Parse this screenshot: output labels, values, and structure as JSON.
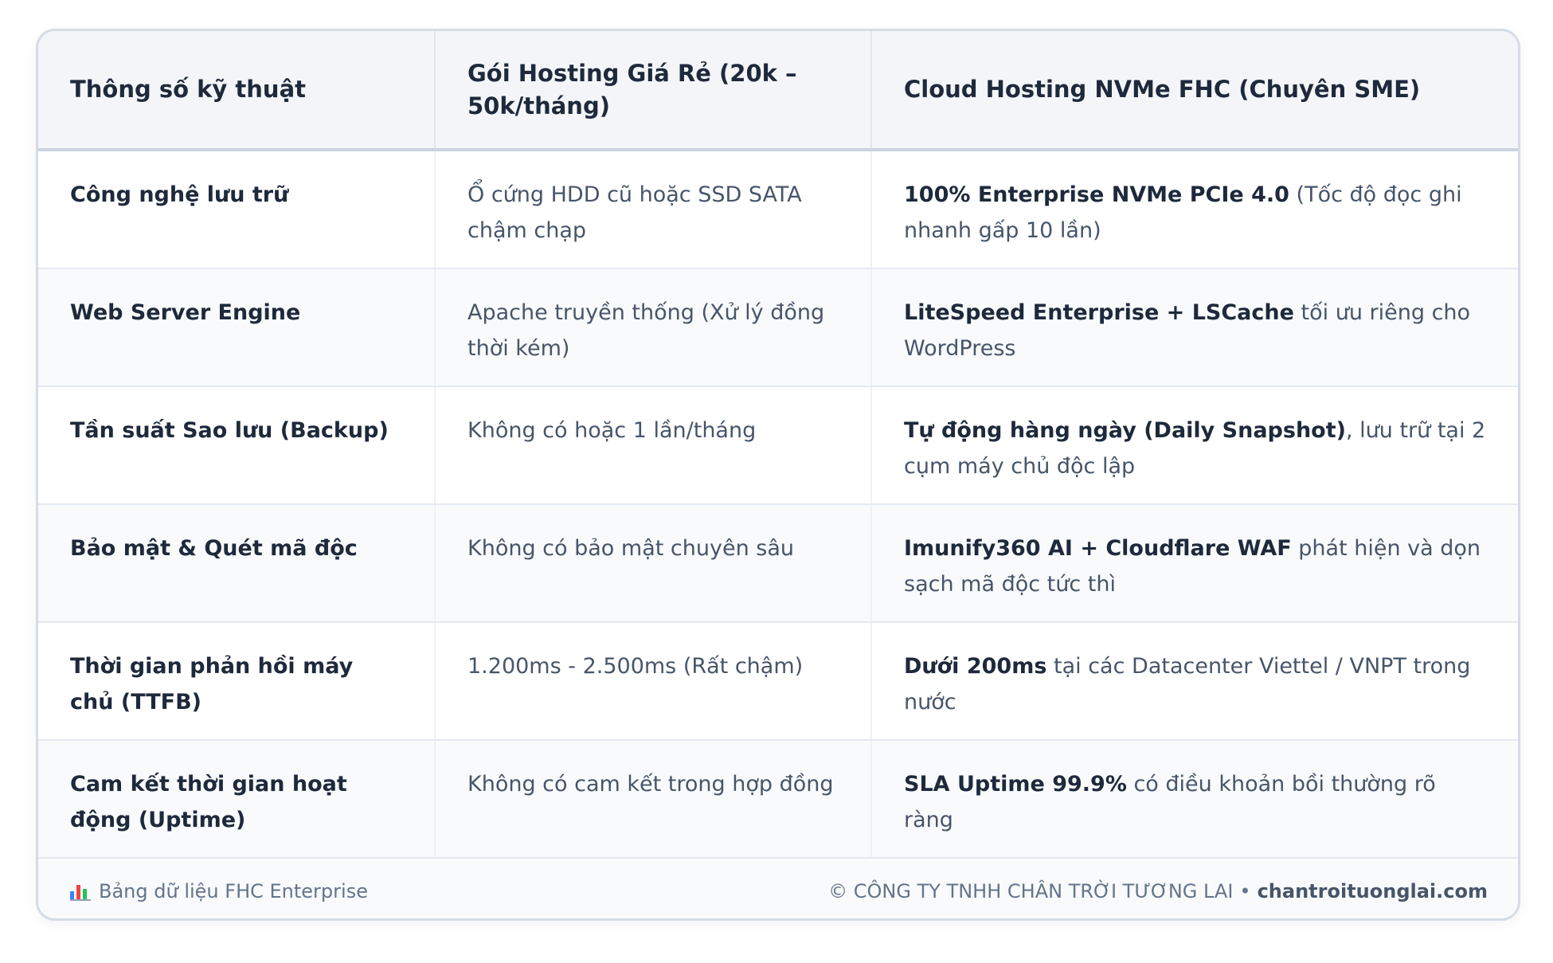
{
  "table": {
    "headers": [
      "Thông số kỹ thuật",
      "Gói Hosting Giá Rẻ (20k – 50k/tháng)",
      "Cloud Hosting NVMe FHC (Chuyên SME)"
    ],
    "rows": [
      {
        "spec": "Công nghệ lưu trữ",
        "cheap": "Ổ cứng HDD cũ hoặc SSD SATA chậm chạp",
        "fhc_strong": "100% Enterprise NVMe PCIe 4.0",
        "fhc_rest": " (Tốc độ đọc ghi nhanh gấp 10 lần)"
      },
      {
        "spec": "Web Server Engine",
        "cheap": "Apache truyền thống (Xử lý đồng thời kém)",
        "fhc_strong": "LiteSpeed Enterprise + LSCache",
        "fhc_rest": " tối ưu riêng cho WordPress"
      },
      {
        "spec": "Tần suất Sao lưu (Backup)",
        "cheap": "Không có hoặc 1 lần/tháng",
        "fhc_strong": "Tự động hàng ngày (Daily Snapshot)",
        "fhc_rest": ", lưu trữ tại 2 cụm máy chủ độc lập"
      },
      {
        "spec": "Bảo mật & Quét mã độc",
        "cheap": "Không có bảo mật chuyên sâu",
        "fhc_strong": "Imunify360 AI + Cloudflare WAF",
        "fhc_rest": " phát hiện và dọn sạch mã độc tức thì"
      },
      {
        "spec": "Thời gian phản hồi máy chủ (TTFB)",
        "cheap": "1.200ms - 2.500ms (Rất chậm)",
        "fhc_strong": "Dưới 200ms",
        "fhc_rest": " tại các Datacenter Viettel / VNPT trong nước"
      },
      {
        "spec": "Cam kết thời gian hoạt động (Uptime)",
        "cheap": "Không có cam kết trong hợp đồng",
        "fhc_strong": "SLA Uptime 99.9%",
        "fhc_rest": " có điều khoản bồi thường rõ ràng"
      }
    ]
  },
  "footer": {
    "left_icon": "bar-chart-icon",
    "left_text": "Bảng dữ liệu FHC Enterprise",
    "company": "© CÔNG TY TNHH CHÂN TRỜI TƯƠNG LAI",
    "separator": "•",
    "website": "chantroituonglai.com"
  },
  "colors": {
    "header_bg": "#f3f5f9",
    "alt_row_bg": "#f8fafc",
    "text_dark": "#1e293b",
    "text_muted": "#475569",
    "border": "#d5dce6"
  }
}
